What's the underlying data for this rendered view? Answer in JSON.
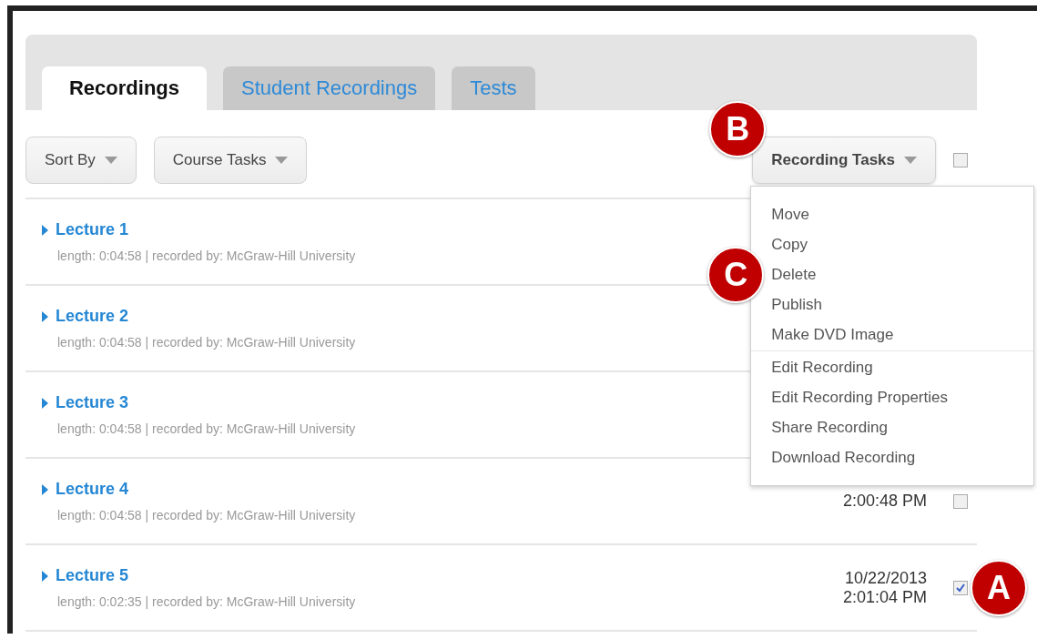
{
  "tabs": [
    {
      "label": "Recordings",
      "selected": true
    },
    {
      "label": "Student Recordings",
      "selected": false
    },
    {
      "label": "Tests",
      "selected": false
    }
  ],
  "toolbar": {
    "left_buttons": [
      "Sort By",
      "Course Tasks"
    ],
    "recording_tasks": {
      "label": "Recording Tasks",
      "expanded": true,
      "callout": "B"
    },
    "select_all": {
      "checked": false
    }
  },
  "menu": {
    "items": [
      {
        "label": "Move"
      },
      {
        "label": "Copy"
      },
      {
        "label": "Delete",
        "callout": "C"
      },
      {
        "label": "Publish"
      },
      {
        "label": "Make DVD Image",
        "divider_after": true
      },
      {
        "label": "Edit Recording"
      },
      {
        "label": "Edit Recording Properties"
      },
      {
        "label": "Share Recording"
      },
      {
        "label": "Download Recording"
      }
    ]
  },
  "recordings": [
    {
      "title": "Lecture 1",
      "meta": "length: 0:04:58 | recorded by: McGraw-Hill University"
    },
    {
      "title": "Lecture 2",
      "meta": "length: 0:04:58 | recorded by: McGraw-Hill University"
    },
    {
      "title": "Lecture 3",
      "meta": "length: 0:04:58 | recorded by: McGraw-Hill University"
    },
    {
      "title": "Lecture 4",
      "meta": "length: 0:04:58 | recorded by: McGraw-Hill University",
      "time": "2:00:48 PM",
      "checked": false
    },
    {
      "title": "Lecture 5",
      "meta": "length: 0:02:35 | recorded by: McGraw-Hill University",
      "date": "10/22/2013",
      "time": "2:01:04 PM",
      "checked": true,
      "callout": "A"
    }
  ]
}
